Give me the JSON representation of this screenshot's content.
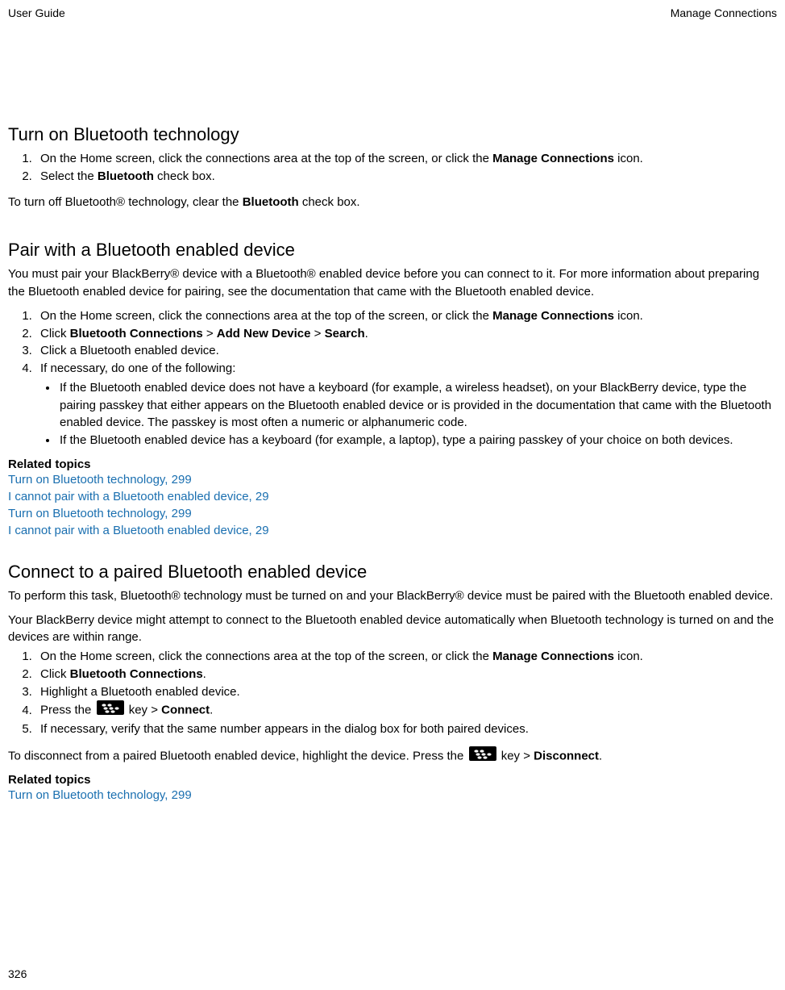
{
  "header": {
    "left": "User Guide",
    "right": "Manage Connections"
  },
  "section1": {
    "title": "Turn on Bluetooth technology",
    "step1_pre": "On the Home screen, click the connections area at the top of the screen, or click the ",
    "step1_bold": "Manage Connections",
    "step1_post": " icon.",
    "step2_pre": "Select the ",
    "step2_bold": "Bluetooth",
    "step2_post": " check box.",
    "note_pre": "To turn off Bluetooth® technology, clear the ",
    "note_bold": "Bluetooth",
    "note_post": " check box."
  },
  "section2": {
    "title": "Pair with a Bluetooth enabled device",
    "intro": "You must pair your BlackBerry® device with a Bluetooth® enabled device before you can connect to it. For more information about preparing the Bluetooth enabled device for pairing, see the documentation that came with the Bluetooth enabled device.",
    "s1_pre": "On the Home screen, click the connections area at the top of the screen, or click the ",
    "s1_bold": "Manage Connections",
    "s1_post": " icon.",
    "s2_pre": "Click ",
    "s2_b1": "Bluetooth Connections",
    "s2_mid1": " > ",
    "s2_b2": "Add New Device",
    "s2_mid2": " > ",
    "s2_b3": "Search",
    "s2_post": ".",
    "s3": "Click a Bluetooth enabled device.",
    "s4": "If necessary, do one of the following:",
    "s4_b1": "If the Bluetooth enabled device does not have a keyboard (for example, a wireless headset), on your BlackBerry device, type the pairing passkey that either appears on the Bluetooth enabled device or is provided in the documentation that came with the Bluetooth enabled device. The passkey is most often a numeric or alphanumeric code.",
    "s4_b2": "If the Bluetooth enabled device has a keyboard (for example, a laptop), type a pairing passkey of your choice on both devices.",
    "related_heading": "Related topics",
    "links": [
      "Turn on Bluetooth technology, 299",
      "I cannot pair with a Bluetooth enabled device, 29",
      "Turn on Bluetooth technology, 299",
      "I cannot pair with a Bluetooth enabled device, 29"
    ]
  },
  "section3": {
    "title": "Connect to a paired Bluetooth enabled device",
    "intro1": "To perform this task, Bluetooth® technology must be turned on and your BlackBerry® device must be paired with the Bluetooth enabled device.",
    "intro2": "Your BlackBerry device might attempt to connect to the Bluetooth enabled device automatically when Bluetooth technology is turned on and the devices are within range.",
    "s1_pre": "On the Home screen, click the connections area at the top of the screen, or click the ",
    "s1_bold": "Manage Connections",
    "s1_post": " icon.",
    "s2_pre": "Click ",
    "s2_bold": "Bluetooth Connections",
    "s2_post": ".",
    "s3": "Highlight a Bluetooth enabled device.",
    "s4_pre": "Press the ",
    "s4_mid": " key > ",
    "s4_bold": "Connect",
    "s4_post": ".",
    "s5": "If necessary, verify that the same number appears in the dialog box for both paired devices.",
    "disc_pre": "To disconnect from a paired Bluetooth enabled device, highlight the device. Press the ",
    "disc_mid": " key > ",
    "disc_bold": "Disconnect",
    "disc_post": ".",
    "related_heading": "Related topics",
    "links": [
      "Turn on Bluetooth technology, 299"
    ]
  },
  "page_number": "326"
}
